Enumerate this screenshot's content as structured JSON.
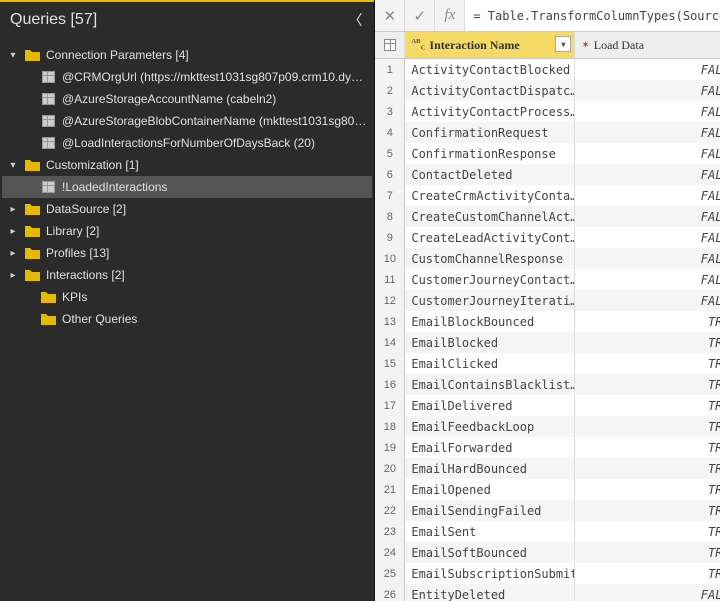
{
  "sidebar": {
    "title": "Queries [57]",
    "tree": [
      {
        "kind": "folder",
        "depth": 0,
        "caret": "▾",
        "label": "Connection Parameters [4]",
        "expanded": true
      },
      {
        "kind": "item",
        "depth": 1,
        "label": "@CRMOrgUrl (https://mkttest1031sg807p09.crm10.dy…"
      },
      {
        "kind": "item",
        "depth": 1,
        "label": "@AzureStorageAccountName (cabeln2)"
      },
      {
        "kind": "item",
        "depth": 1,
        "label": "@AzureStorageBlobContainerName (mkttest1031sg80…"
      },
      {
        "kind": "item",
        "depth": 1,
        "label": "@LoadInteractionsForNumberOfDaysBack (20)"
      },
      {
        "kind": "folder",
        "depth": 0,
        "caret": "▾",
        "label": "Customization [1]",
        "expanded": true
      },
      {
        "kind": "item",
        "depth": 1,
        "label": "!LoadedInteractions",
        "selected": true
      },
      {
        "kind": "folder",
        "depth": 0,
        "caret": "▸",
        "label": "DataSource [2]"
      },
      {
        "kind": "folder",
        "depth": 0,
        "caret": "▸",
        "label": "Library [2]"
      },
      {
        "kind": "folder",
        "depth": 0,
        "caret": "▸",
        "label": "Profiles [13]"
      },
      {
        "kind": "folder",
        "depth": 0,
        "caret": "▸",
        "label": "Interactions [2]"
      },
      {
        "kind": "folder",
        "depth": 1,
        "caret": "",
        "label": "KPIs",
        "noCaret": true
      },
      {
        "kind": "folder",
        "depth": 1,
        "caret": "",
        "label": "Other Queries",
        "noCaret": true
      }
    ]
  },
  "formula": "= Table.TransformColumnTypes(Source,{{",
  "columns": {
    "a": {
      "typelabel": "ABC",
      "name": "Interaction Name"
    },
    "b": {
      "typeicon": "⤫",
      "name": "Load Data"
    }
  },
  "rows": [
    {
      "n": 1,
      "a": "ActivityContactBlocked",
      "b": "FALSE"
    },
    {
      "n": 2,
      "a": "ActivityContactDispatc…",
      "b": "FALSE"
    },
    {
      "n": 3,
      "a": "ActivityContactProcess…",
      "b": "FALSE"
    },
    {
      "n": 4,
      "a": "ConfirmationRequest",
      "b": "FALSE"
    },
    {
      "n": 5,
      "a": "ConfirmationResponse",
      "b": "FALSE"
    },
    {
      "n": 6,
      "a": "ContactDeleted",
      "b": "FALSE"
    },
    {
      "n": 7,
      "a": "CreateCrmActivityConta…",
      "b": "FALSE"
    },
    {
      "n": 8,
      "a": "CreateCustomChannelAct…",
      "b": "FALSE"
    },
    {
      "n": 9,
      "a": "CreateLeadActivityCont…",
      "b": "FALSE"
    },
    {
      "n": 10,
      "a": "CustomChannelResponse",
      "b": "FALSE"
    },
    {
      "n": 11,
      "a": "CustomerJourneyContact…",
      "b": "FALSE"
    },
    {
      "n": 12,
      "a": "CustomerJourneyIterati…",
      "b": "FALSE"
    },
    {
      "n": 13,
      "a": "EmailBlockBounced",
      "b": "TRUE"
    },
    {
      "n": 14,
      "a": "EmailBlocked",
      "b": "TRUE"
    },
    {
      "n": 15,
      "a": "EmailClicked",
      "b": "TRUE"
    },
    {
      "n": 16,
      "a": "EmailContainsBlacklist…",
      "b": "TRUE"
    },
    {
      "n": 17,
      "a": "EmailDelivered",
      "b": "TRUE"
    },
    {
      "n": 18,
      "a": "EmailFeedbackLoop",
      "b": "TRUE"
    },
    {
      "n": 19,
      "a": "EmailForwarded",
      "b": "TRUE"
    },
    {
      "n": 20,
      "a": "EmailHardBounced",
      "b": "TRUE"
    },
    {
      "n": 21,
      "a": "EmailOpened",
      "b": "TRUE"
    },
    {
      "n": 22,
      "a": "EmailSendingFailed",
      "b": "TRUE"
    },
    {
      "n": 23,
      "a": "EmailSent",
      "b": "TRUE"
    },
    {
      "n": 24,
      "a": "EmailSoftBounced",
      "b": "TRUE"
    },
    {
      "n": 25,
      "a": "EmailSubscriptionSubmit",
      "b": "TRUE"
    },
    {
      "n": 26,
      "a": "EntityDeleted",
      "b": "FALSE"
    }
  ]
}
